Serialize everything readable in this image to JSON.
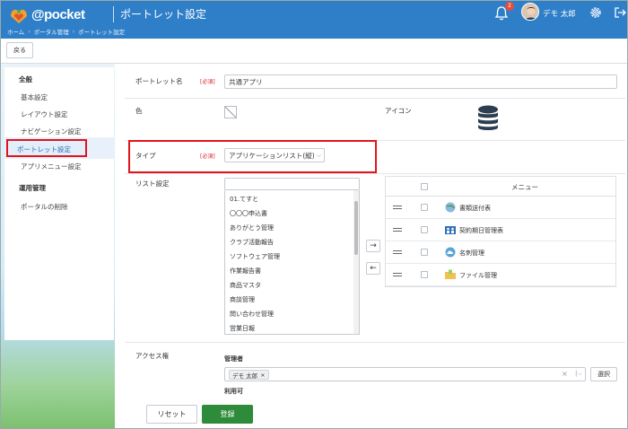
{
  "header": {
    "logo_text": "@pocket",
    "page_title": "ポートレット設定",
    "breadcrumb": [
      "ホーム",
      "ポータル管理",
      "ポートレット設定"
    ],
    "notification_count": "2",
    "user_name": "デモ 太郎"
  },
  "toolbar": {
    "back_label": "戻る"
  },
  "sidebar": {
    "sections": [
      {
        "heading": "全般",
        "items": [
          "基本設定",
          "レイアウト設定",
          "ナビゲーション設定",
          "ポートレット設定",
          "アプリメニュー設定"
        ]
      },
      {
        "heading": "運用管理",
        "items": [
          "ポータルの削除"
        ]
      }
    ],
    "active_item": "ポートレット設定"
  },
  "form": {
    "portlet_name_label": "ポートレット名",
    "required_label": "[必須]",
    "portlet_name_value": "共通アプリ",
    "color_label": "色",
    "icon_label": "アイコン",
    "icon_name": "database-icon",
    "type_label": "タイプ",
    "type_value": "アプリケーションリスト(縦)",
    "list_label": "リスト設定",
    "list_search_value": "",
    "list_items": [
      "01.てすと",
      "〇〇〇申込書",
      "ありがとう管理",
      "クラブ活動報告",
      "ソフトウェア管理",
      "作業報告書",
      "商品マスタ",
      "商談管理",
      "問い合わせ管理",
      "営業日報"
    ],
    "menu_header": "メニュー",
    "menu_items": [
      {
        "label": "書類送付表",
        "icon": "globe-icon"
      },
      {
        "label": "契約期日管理表",
        "icon": "people-icon"
      },
      {
        "label": "名刺管理",
        "icon": "cloud-icon"
      },
      {
        "label": "ファイル管理",
        "icon": "folder-icon"
      }
    ],
    "access_label": "アクセス権",
    "admin_label": "管理者",
    "admin_tag": "デモ 太郎",
    "select_button": "選択",
    "usable_label": "利用可",
    "reset_button": "リセット",
    "save_button": "登録"
  },
  "colors": {
    "header_bg": "#2f7fc8",
    "highlight_red": "#e0141c",
    "save_green": "#2e8b3a",
    "required_red": "#d9262c"
  }
}
